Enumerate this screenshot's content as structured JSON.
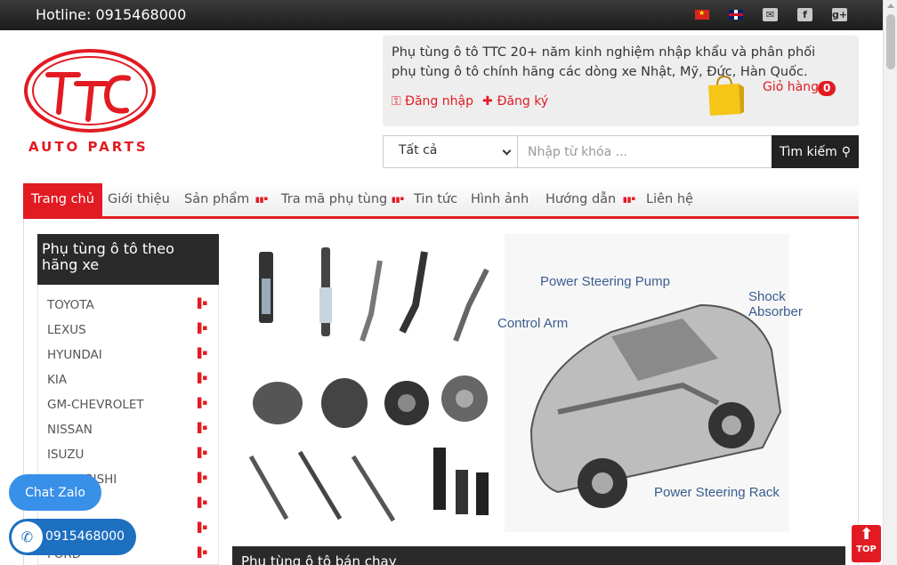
{
  "topbar": {
    "hotline": "Hotline: 0915468000",
    "icons": [
      "flag-vn-icon",
      "flag-uk-icon",
      "mail-icon",
      "facebook-icon",
      "google-plus-icon"
    ]
  },
  "logo": {
    "brand": "TTC",
    "tagline": "AUTO PARTS"
  },
  "header": {
    "slogan": "Phụ tùng ô tô TTC 20+ năm kinh nghiệm nhập khẩu và phân phối phụ tùng ô tô chính hãng các dòng xe Nhật, Mỹ, Đức, Hàn Quốc.",
    "login": "Đăng nhập",
    "register": "Đăng ký",
    "cart_label": "Giỏ hàng",
    "cart_count": "0"
  },
  "search": {
    "category": "Tất cả",
    "placeholder": "Nhập từ khóa ...",
    "button": "Tìm kiếm"
  },
  "nav": {
    "items": [
      "Trang chủ",
      "Giới thiệu",
      "Sản phẩm",
      "Tra mã phụ tùng",
      "Tin tức",
      "Hình ảnh",
      "Hướng dẫn",
      "Liên hệ"
    ]
  },
  "sidebar": {
    "title": "Phụ tùng ô tô theo hãng xe",
    "items": [
      "TOYOTA",
      "LEXUS",
      "HYUNDAI",
      "KIA",
      "GM-CHEVROLET",
      "NISSAN",
      "ISUZU",
      "MITSUBISHI",
      "",
      "",
      "FORD"
    ]
  },
  "banner": {
    "labels": [
      "Power Steering Pump",
      "Shock Absorber",
      "Control Arm",
      "Power Steering Rack"
    ]
  },
  "section": {
    "bestseller_title": "Phụ tùng ô tô bán chạy"
  },
  "floating": {
    "zalo": "Chat Zalo",
    "phone": "0915468000",
    "top": "TOP"
  },
  "colors": {
    "accent": "#e21b22",
    "dark": "#2a2a2a",
    "zalo": "#3890e8"
  }
}
